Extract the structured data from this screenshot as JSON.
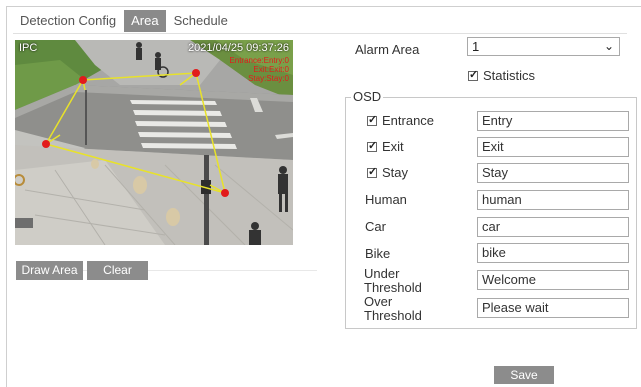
{
  "tabs": [
    {
      "label": "Detection Config",
      "active": false
    },
    {
      "label": "Area",
      "active": true
    },
    {
      "label": "Schedule",
      "active": false
    }
  ],
  "camera": {
    "label": "IPC",
    "timestamp": "2021/04/25 09:37:26",
    "osd_lines": [
      "Entrance:Entry:0",
      "Exit:Exit:0",
      "Stay:Stay:0"
    ]
  },
  "buttons": {
    "draw_area": "Draw Area",
    "clear": "Clear",
    "save": "Save"
  },
  "form": {
    "alarm_area_label": "Alarm Area",
    "alarm_area_value": "1",
    "statistics_label": "Statistics",
    "osd_legend": "OSD",
    "rows": [
      {
        "label": "Entrance",
        "checkbox": true,
        "value": "Entry"
      },
      {
        "label": "Exit",
        "checkbox": true,
        "value": "Exit"
      },
      {
        "label": "Stay",
        "checkbox": true,
        "value": "Stay"
      },
      {
        "label": "Human",
        "checkbox": false,
        "value": "human"
      },
      {
        "label": "Car",
        "checkbox": false,
        "value": "car"
      },
      {
        "label": "Bike",
        "checkbox": false,
        "value": "bike"
      }
    ],
    "under_threshold": {
      "label_line1": "Under",
      "label_line2": "Threshold",
      "value": "Welcome"
    },
    "over_threshold": {
      "label_line1": "Over",
      "label_line2": "Threshold",
      "value": "Please wait"
    }
  },
  "colors": {
    "tab_active": "#8a8a8a",
    "button_gray": "#8c8c8c",
    "area_line": "#e8e22a",
    "area_point": "#e21b1b",
    "osd_text": "#e21b1b"
  }
}
